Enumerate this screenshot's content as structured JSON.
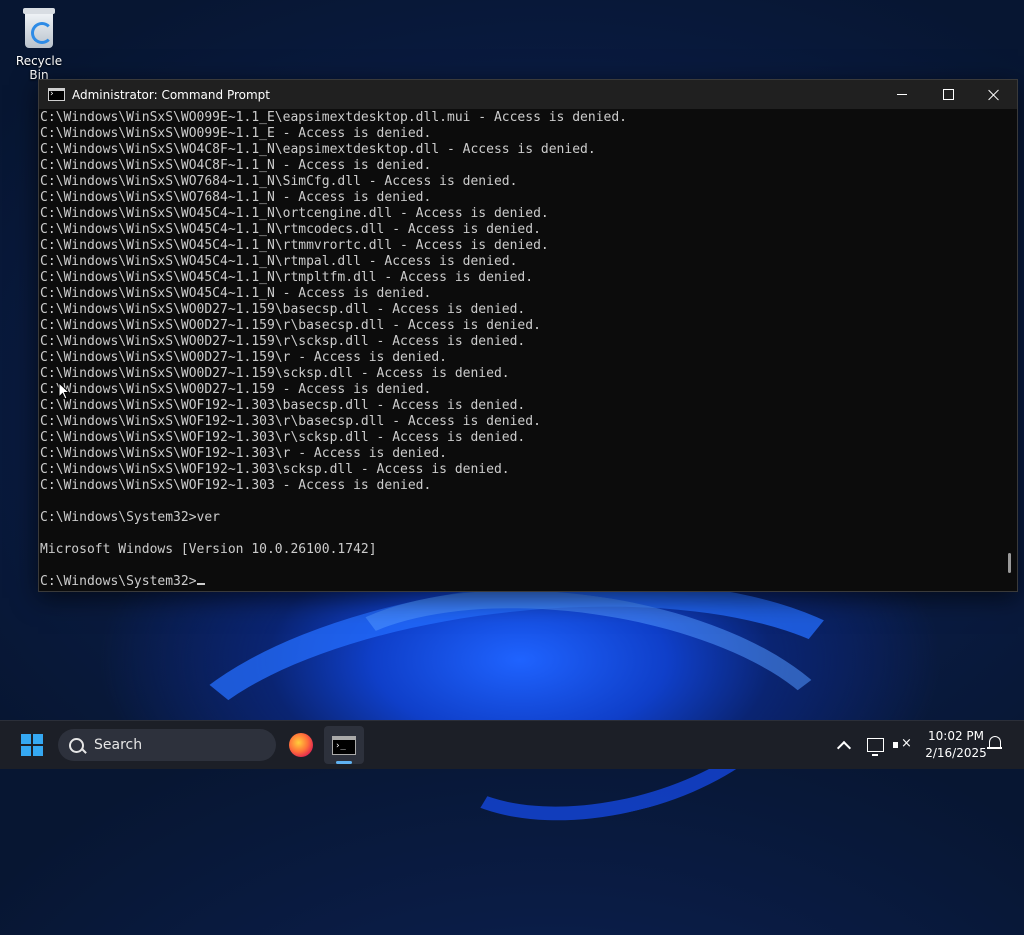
{
  "desktop": {
    "icons": [
      {
        "label": "Recycle Bin",
        "icon": "recycle-bin-icon"
      }
    ]
  },
  "window": {
    "title": "Administrator: Command Prompt",
    "icon": "command-prompt-icon",
    "controls": [
      "minimize-icon",
      "maximize-icon",
      "close-icon"
    ]
  },
  "console": {
    "lines": [
      "C:\\Windows\\WinSxS\\WO099E~1.1_E\\eapsimextdesktop.dll.mui - Access is denied.",
      "C:\\Windows\\WinSxS\\WO099E~1.1_E - Access is denied.",
      "C:\\Windows\\WinSxS\\WO4C8F~1.1_N\\eapsimextdesktop.dll - Access is denied.",
      "C:\\Windows\\WinSxS\\WO4C8F~1.1_N - Access is denied.",
      "C:\\Windows\\WinSxS\\WO7684~1.1_N\\SimCfg.dll - Access is denied.",
      "C:\\Windows\\WinSxS\\WO7684~1.1_N - Access is denied.",
      "C:\\Windows\\WinSxS\\WO45C4~1.1_N\\ortcengine.dll - Access is denied.",
      "C:\\Windows\\WinSxS\\WO45C4~1.1_N\\rtmcodecs.dll - Access is denied.",
      "C:\\Windows\\WinSxS\\WO45C4~1.1_N\\rtmmvrortc.dll - Access is denied.",
      "C:\\Windows\\WinSxS\\WO45C4~1.1_N\\rtmpal.dll - Access is denied.",
      "C:\\Windows\\WinSxS\\WO45C4~1.1_N\\rtmpltfm.dll - Access is denied.",
      "C:\\Windows\\WinSxS\\WO45C4~1.1_N - Access is denied.",
      "C:\\Windows\\WinSxS\\WO0D27~1.159\\basecsp.dll - Access is denied.",
      "C:\\Windows\\WinSxS\\WO0D27~1.159\\r\\basecsp.dll - Access is denied.",
      "C:\\Windows\\WinSxS\\WO0D27~1.159\\r\\scksp.dll - Access is denied.",
      "C:\\Windows\\WinSxS\\WO0D27~1.159\\r - Access is denied.",
      "C:\\Windows\\WinSxS\\WO0D27~1.159\\scksp.dll - Access is denied.",
      "C:\\Windows\\WinSxS\\WO0D27~1.159 - Access is denied.",
      "C:\\Windows\\WinSxS\\WOF192~1.303\\basecsp.dll - Access is denied.",
      "C:\\Windows\\WinSxS\\WOF192~1.303\\r\\basecsp.dll - Access is denied.",
      "C:\\Windows\\WinSxS\\WOF192~1.303\\r\\scksp.dll - Access is denied.",
      "C:\\Windows\\WinSxS\\WOF192~1.303\\r - Access is denied.",
      "C:\\Windows\\WinSxS\\WOF192~1.303\\scksp.dll - Access is denied.",
      "C:\\Windows\\WinSxS\\WOF192~1.303 - Access is denied.",
      "",
      "C:\\Windows\\System32>ver",
      "",
      "Microsoft Windows [Version 10.0.26100.1742]",
      ""
    ],
    "prompt": "C:\\Windows\\System32>"
  },
  "taskbar": {
    "start_icon": "windows-start-icon",
    "search_placeholder": "Search",
    "apps": [
      {
        "name": "Firefox",
        "icon": "firefox-icon"
      },
      {
        "name": "Command Prompt",
        "icon": "command-prompt-icon",
        "active": true
      }
    ],
    "tray_icons": [
      "chevron-up-icon",
      "network-icon",
      "volume-muted-icon",
      "notification-bell-icon"
    ],
    "time": "10:02 PM",
    "date": "2/16/2025"
  },
  "colors": {
    "console_bg": "#0c0c0c",
    "console_text": "#cccccc",
    "titlebar_bg": "#202020",
    "taskbar_bg": "#1c1f27",
    "accent": "#35a8f2"
  }
}
